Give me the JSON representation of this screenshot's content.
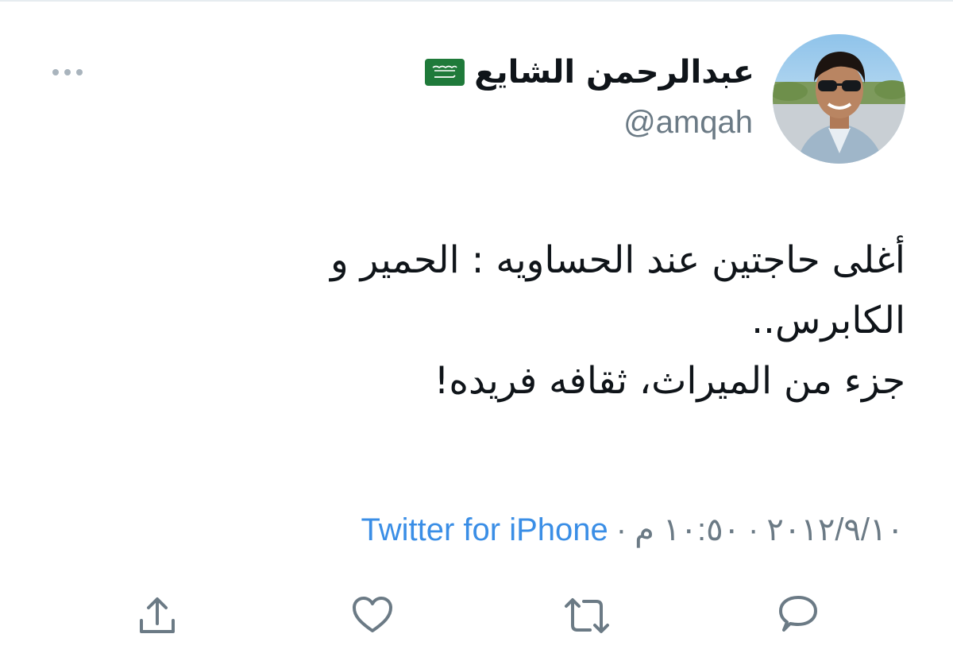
{
  "author": {
    "display_name": "عبدالرحمن الشايع",
    "handle": "@amqah",
    "flag_icon": "saudi-arabia-flag-icon",
    "avatar": "profile-photo"
  },
  "tweet": {
    "lines": [
      "أغلى حاجتين عند الحساويه : الحمير و",
      "الكابرس..",
      "جزء من الميراث، ثقافه فريده!"
    ]
  },
  "meta": {
    "date": "٢٠١٢/٩/١٠",
    "separator": "·",
    "time": "١٠:٥٠ م",
    "source": "Twitter for iPhone"
  },
  "actions": [
    {
      "icon": "share-icon"
    },
    {
      "icon": "like-heart-icon"
    },
    {
      "icon": "retweet-icon"
    },
    {
      "icon": "reply-icon"
    }
  ],
  "colors": {
    "link": "#3a8ee6",
    "secondary_text": "#6b7a85",
    "icon": "#6b7a85",
    "flag_green": "#1f7a3a"
  }
}
